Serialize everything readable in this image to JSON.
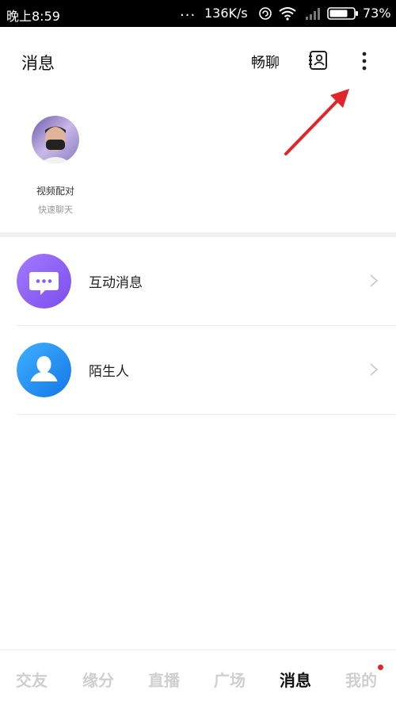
{
  "status_bar": {
    "time": "晚上8:59",
    "dots": "...",
    "net_speed": "136K/s",
    "battery": "73%"
  },
  "header": {
    "title": "消息",
    "chat_label": "畅聊",
    "contacts_icon": "contacts-icon",
    "more_icon": "more-vertical-icon"
  },
  "video_match": {
    "title": "视频配对",
    "subtitle": "快速聊天"
  },
  "list": [
    {
      "label": "互动消息",
      "icon": "chat-bubble-icon",
      "color": "#8a5cf6"
    },
    {
      "label": "陌生人",
      "icon": "person-icon",
      "color": "#1a8cf0"
    }
  ],
  "tabs": [
    {
      "label": "交友",
      "active": false
    },
    {
      "label": "缘分",
      "active": false
    },
    {
      "label": "直播",
      "active": false
    },
    {
      "label": "广场",
      "active": false
    },
    {
      "label": "消息",
      "active": true
    },
    {
      "label": "我的",
      "active": false
    }
  ],
  "colors": {
    "annotation_arrow": "#e0262b",
    "notify_dot": "#e0262b"
  }
}
